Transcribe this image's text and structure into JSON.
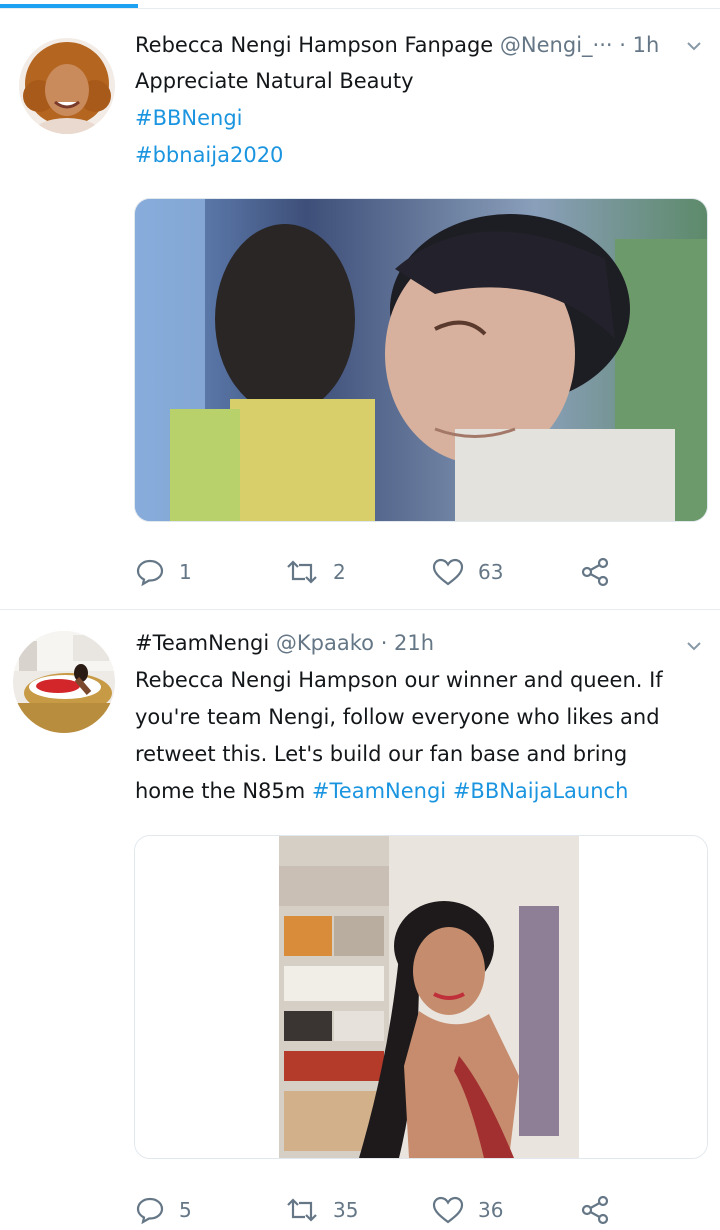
{
  "tweets": [
    {
      "author": "Rebecca Nengi Hampson Fanpage",
      "handle": "@Nengi_···",
      "time": "· 1h",
      "lines": [
        "Appreciate Natural Beauty"
      ],
      "hashtags": [
        "#BBNengi",
        "#bbnaija2020"
      ],
      "replies": "1",
      "retweets": "2",
      "likes": "63",
      "icons": [
        "reply-icon",
        "retweet-icon",
        "like-icon",
        "share-icon"
      ]
    },
    {
      "author": "#TeamNengi",
      "handle": "@Kpaako",
      "time": "· 21h",
      "line1": "Rebecca Nengi Hampson our winner and queen. If",
      "line2": "you're team Nengi, follow everyone who likes and",
      "line3": "retweet this. Let's build our fan base and bring",
      "line4_text": "home the N85m ",
      "line4_tag1": "#TeamNengi",
      "line4_tag2": "#BBNaijaLaunch",
      "replies": "5",
      "retweets": "35",
      "likes": "36"
    }
  ],
  "colors": {
    "accent": "#1da1f2",
    "link": "#1b95e0",
    "text": "#14171a",
    "muted": "#657786",
    "divider": "#e6ecf0"
  }
}
